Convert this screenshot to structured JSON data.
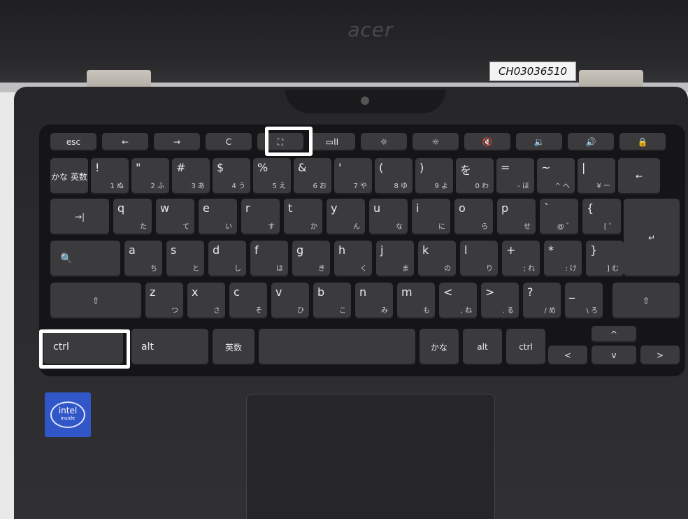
{
  "laptop": {
    "brand": "acer",
    "asset_label": "CH03036510",
    "intel_badge": {
      "top": "intel",
      "bottom": "inside"
    }
  },
  "keyboard": {
    "fn_row": [
      "esc",
      "←",
      "→",
      "C",
      "⛶",
      "▭II",
      "☼",
      "☼",
      "🔇",
      "🔉",
      "🔊",
      "🔒"
    ],
    "num_row": [
      {
        "main": "かな\n英数",
        "sub": ""
      },
      {
        "main": "!",
        "sub": "1 ぬ"
      },
      {
        "main": "\"",
        "sub": "2 ふ"
      },
      {
        "main": "#",
        "sub": "3 あ"
      },
      {
        "main": "$",
        "sub": "4 う"
      },
      {
        "main": "%",
        "sub": "5 え"
      },
      {
        "main": "&",
        "sub": "6 お"
      },
      {
        "main": "'",
        "sub": "7 や"
      },
      {
        "main": "(",
        "sub": "8 ゆ"
      },
      {
        "main": ")",
        "sub": "9 よ"
      },
      {
        "main": "を",
        "sub": "0 わ"
      },
      {
        "main": "=",
        "sub": "- ほ"
      },
      {
        "main": "~",
        "sub": "^ へ"
      },
      {
        "main": "|",
        "sub": "¥ ー"
      },
      {
        "main": "←",
        "sub": ""
      }
    ],
    "row2": [
      {
        "main": "→|",
        "sub": ""
      },
      {
        "main": "q",
        "sub": "た"
      },
      {
        "main": "w",
        "sub": "て"
      },
      {
        "main": "e",
        "sub": "い"
      },
      {
        "main": "r",
        "sub": "す"
      },
      {
        "main": "t",
        "sub": "か"
      },
      {
        "main": "y",
        "sub": "ん"
      },
      {
        "main": "u",
        "sub": "な"
      },
      {
        "main": "i",
        "sub": "に"
      },
      {
        "main": "o",
        "sub": "ら"
      },
      {
        "main": "p",
        "sub": "せ"
      },
      {
        "main": "`",
        "sub": "@ ゛"
      },
      {
        "main": "{",
        "sub": "[ ゜"
      },
      {
        "main": "↵",
        "sub": ""
      }
    ],
    "row3": [
      {
        "main": "🔍",
        "sub": ""
      },
      {
        "main": "a",
        "sub": "ち"
      },
      {
        "main": "s",
        "sub": "と"
      },
      {
        "main": "d",
        "sub": "し"
      },
      {
        "main": "f",
        "sub": "は"
      },
      {
        "main": "g",
        "sub": "き"
      },
      {
        "main": "h",
        "sub": "く"
      },
      {
        "main": "j",
        "sub": "ま"
      },
      {
        "main": "k",
        "sub": "の"
      },
      {
        "main": "l",
        "sub": "り"
      },
      {
        "main": "+",
        "sub": "; れ"
      },
      {
        "main": "*",
        "sub": ": け"
      },
      {
        "main": "}",
        "sub": "] む"
      }
    ],
    "row4": [
      {
        "main": "⇧",
        "sub": ""
      },
      {
        "main": "z",
        "sub": "つ"
      },
      {
        "main": "x",
        "sub": "さ"
      },
      {
        "main": "c",
        "sub": "そ"
      },
      {
        "main": "v",
        "sub": "ひ"
      },
      {
        "main": "b",
        "sub": "こ"
      },
      {
        "main": "n",
        "sub": "み"
      },
      {
        "main": "m",
        "sub": "も"
      },
      {
        "main": "<",
        "sub": ", ね"
      },
      {
        "main": ">",
        "sub": ". る"
      },
      {
        "main": "?",
        "sub": "/ め"
      },
      {
        "main": "_",
        "sub": "\\ ろ"
      },
      {
        "main": "⇧",
        "sub": ""
      }
    ],
    "row5": [
      "ctrl",
      "alt",
      "英数",
      "",
      "かな",
      "alt",
      "ctrl"
    ],
    "arrows": [
      "<",
      "^",
      "v",
      ">"
    ]
  },
  "highlights": [
    "fullscreen-key",
    "ctrl-key"
  ]
}
